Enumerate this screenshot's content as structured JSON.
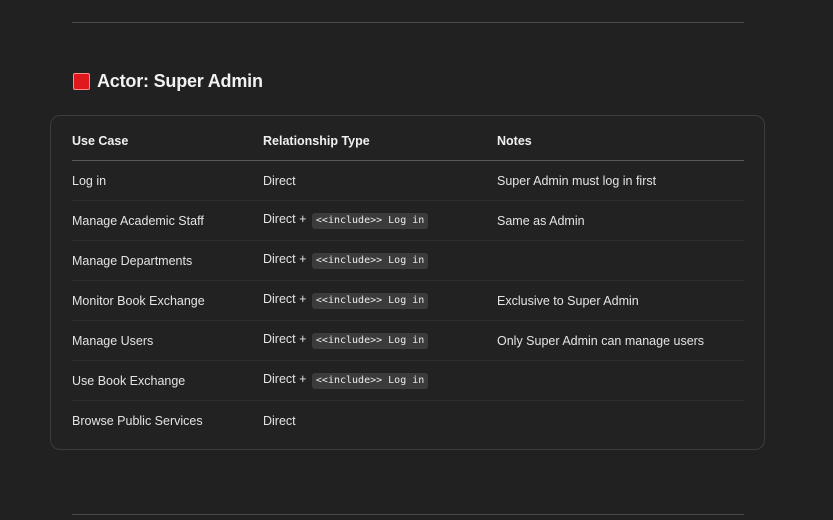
{
  "section": {
    "title": "Actor: Super Admin",
    "marker_color": "#e0191f"
  },
  "table": {
    "headers": [
      "Use Case",
      "Relationship Type",
      "Notes"
    ],
    "rows": [
      {
        "use_case": "Log in",
        "rel": "Direct",
        "code": "",
        "notes": "Super Admin must log in first"
      },
      {
        "use_case": "Manage Academic Staff",
        "rel": "Direct +",
        "code": "<<include>> Log in",
        "notes": "Same as Admin"
      },
      {
        "use_case": "Manage Departments",
        "rel": "Direct +",
        "code": "<<include>> Log in",
        "notes": ""
      },
      {
        "use_case": "Monitor Book Exchange",
        "rel": "Direct +",
        "code": "<<include>> Log in",
        "notes": "Exclusive to Super Admin"
      },
      {
        "use_case": "Manage Users",
        "rel": "Direct +",
        "code": "<<include>> Log in",
        "notes": "Only Super Admin can manage users"
      },
      {
        "use_case": "Use Book Exchange",
        "rel": "Direct +",
        "code": "<<include>> Log in",
        "notes": ""
      },
      {
        "use_case": "Browse Public Services",
        "rel": "Direct",
        "code": "",
        "notes": ""
      }
    ]
  }
}
